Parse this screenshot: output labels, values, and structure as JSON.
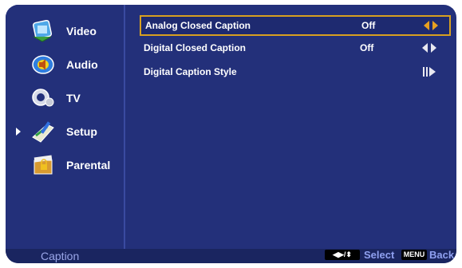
{
  "sidebar": {
    "items": [
      {
        "label": "Video",
        "icon": "video-icon"
      },
      {
        "label": "Audio",
        "icon": "audio-icon"
      },
      {
        "label": "TV",
        "icon": "tv-icon"
      },
      {
        "label": "Setup",
        "icon": "setup-icon",
        "active": true
      },
      {
        "label": "Parental",
        "icon": "parental-icon"
      }
    ]
  },
  "menu": {
    "rows": [
      {
        "label": "Analog Closed Caption",
        "value": "Off",
        "control": "left-right-arrows-icon",
        "selected": true
      },
      {
        "label": "Digital Closed Caption",
        "value": "Off",
        "control": "left-right-arrows-icon"
      },
      {
        "label": "Digital Caption Style",
        "value": "",
        "control": "submenu-arrow-icon"
      }
    ]
  },
  "footer": {
    "title": "Caption",
    "nav_key": "◀▶/⬍",
    "select_label": "Select",
    "menu_key": "MENU",
    "back_label": "Back"
  },
  "colors": {
    "background": "#23307a",
    "highlight_border": "#d8a020",
    "footer_text": "#8fa0f0"
  }
}
